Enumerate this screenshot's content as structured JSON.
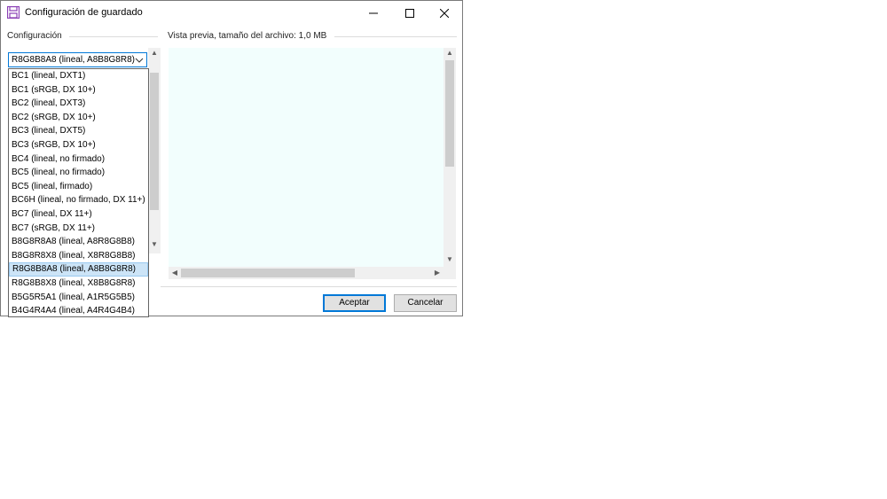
{
  "window": {
    "title": "Configuración de guardado",
    "controls": {
      "minimize": "minimize-icon",
      "maximize": "maximize-icon",
      "close": "close-icon"
    }
  },
  "config": {
    "label": "Configuración",
    "selected": "R8G8B8A8 (lineal, A8B8G8R8)",
    "options": [
      "BC1 (lineal, DXT1)",
      "BC1 (sRGB, DX 10+)",
      "BC2 (lineal, DXT3)",
      "BC2 (sRGB, DX 10+)",
      "BC3 (lineal, DXT5)",
      "BC3 (sRGB, DX 10+)",
      "BC4 (lineal, no firmado)",
      "BC5 (lineal, no firmado)",
      "BC5 (lineal, firmado)",
      "BC6H (lineal, no firmado, DX 11+)",
      "BC7 (lineal, DX 11+)",
      "BC7 (sRGB, DX 11+)",
      "B8G8R8A8 (lineal, A8R8G8B8)",
      "B8G8R8X8 (lineal, X8R8G8B8)",
      "R8G8B8A8 (lineal, A8B8G8R8)",
      "R8G8B8X8 (lineal, X8B8G8R8)",
      "B5G5R5A1 (lineal, A1R5G5B5)",
      "B4G4R4A4 (lineal, A4R4G4B4)"
    ],
    "selected_index": 14
  },
  "preview": {
    "label": "Vista previa, tamaño del archivo: 1,0 MB",
    "background": "#f2fefd"
  },
  "buttons": {
    "ok": "Aceptar",
    "cancel": "Cancelar"
  },
  "colors": {
    "accent": "#0078d7",
    "selection": "#cce4f7"
  }
}
